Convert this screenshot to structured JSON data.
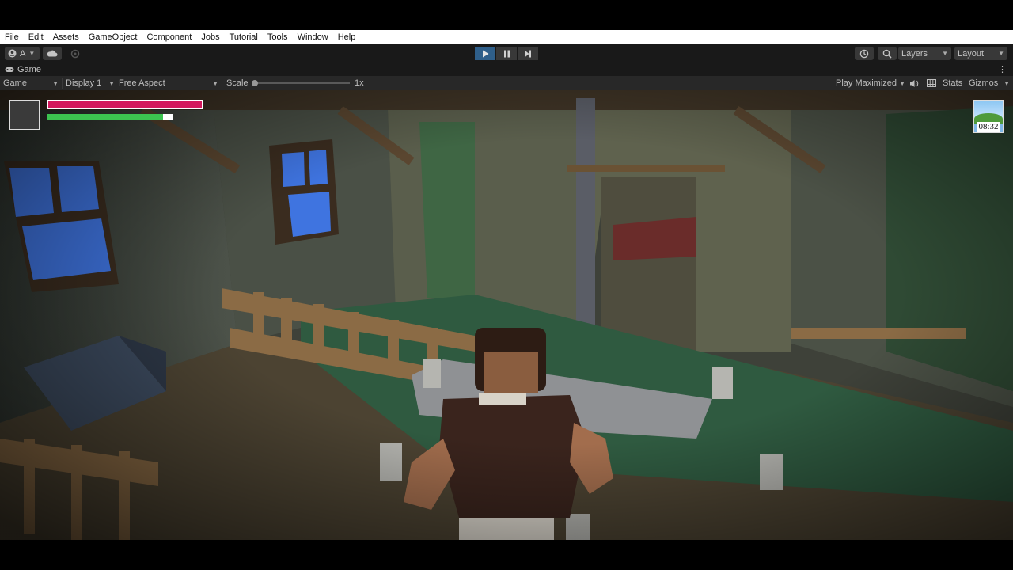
{
  "menu": [
    "File",
    "Edit",
    "Assets",
    "GameObject",
    "Component",
    "Jobs",
    "Tutorial",
    "Tools",
    "Window",
    "Help"
  ],
  "toolbar": {
    "account_label": "A",
    "layers_label": "Layers",
    "layout_label": "Layout"
  },
  "tab": {
    "label": "Game"
  },
  "game_bar": {
    "mode": "Game",
    "display": "Display 1",
    "aspect": "Free Aspect",
    "scale_label": "Scale",
    "scale_value": "1x",
    "play_mode": "Play Maximized",
    "stats": "Stats",
    "gizmos": "Gizmos"
  },
  "hud": {
    "health_fraction": 1.0,
    "stamina_fraction": 0.92,
    "clock_time": "08:32"
  },
  "colors": {
    "health": "#d3185c",
    "stamina": "#3cc450",
    "play_active": "#2f5f8a",
    "window_blue": "#3f74e0"
  },
  "icons": [
    "account-icon",
    "cloud-icon",
    "collab-icon",
    "play-icon",
    "pause-icon",
    "step-icon",
    "history-icon",
    "search-icon",
    "audio-icon",
    "stats-grid-icon",
    "kebab-icon",
    "game-tab-icon"
  ]
}
